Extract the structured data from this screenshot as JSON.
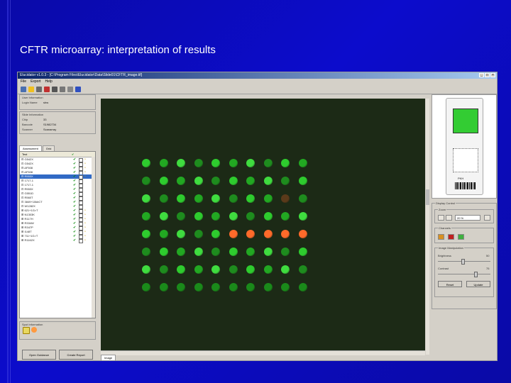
{
  "slide": {
    "title": "CFTR microarray: interpretation of results"
  },
  "window": {
    "title": "Elucidator v1.0.3 - [C:\\Program Files\\Elucidator\\Data\\Slide01\\CFTR_image.tif]",
    "menu": [
      "File",
      "Export",
      "Help"
    ]
  },
  "left": {
    "user_info": {
      "title": "User Information",
      "name_label": "Login Name",
      "name_value": "shw"
    },
    "slide_info": {
      "title": "Slide Information",
      "rows": [
        {
          "label": "Chip",
          "value": "33"
        },
        {
          "label": "Barcode",
          "value": "S1982734"
        },
        {
          "label": "Scanner",
          "value": "Scanarray"
        }
      ]
    },
    "tabs": [
      "Assessment",
      "Grid"
    ],
    "tree_header": "Test",
    "tree_items": [
      {
        "label": "⊟ G542X",
        "check": "none"
      },
      {
        "label": "    ⊡ G542X",
        "check": "none"
      },
      {
        "label": "⊟ ΔF508",
        "check": "none"
      },
      {
        "label": "    ⊡ ΔF508",
        "check": "none"
      },
      {
        "label": "⊟ R553X",
        "check": "none"
      },
      {
        "label": "    ⊟ 1717-1",
        "check": "none"
      },
      {
        "label": "      ⊡ 1717-1",
        "check": "none"
      },
      {
        "label": "      ⊡ R553X",
        "check": "none"
      },
      {
        "label": "      ⊡ G551D",
        "check": "none"
      },
      {
        "label": "      ⊡ R560T",
        "check": "none"
      },
      {
        "label": "      ⊡ 3849+10kbCT",
        "check": "none"
      },
      {
        "label": "      ⊡ W1282X",
        "check": "none"
      },
      {
        "label": "⊞ 621+1G>T",
        "check": "none"
      },
      {
        "label": "⊞ N1303K",
        "check": "none"
      },
      {
        "label": "⊞ R117H",
        "check": "none"
      },
      {
        "label": "⊞ R334W",
        "check": "none"
      },
      {
        "label": "⊞ R347P",
        "check": "none"
      },
      {
        "label": "⊞ I148T",
        "check": "none"
      },
      {
        "label": "⊞ 711+1G>T",
        "check": "none"
      },
      {
        "label": "⊞ R1162X",
        "check": "none"
      }
    ],
    "spot_info": {
      "title": "Spot Information"
    },
    "buttons": {
      "open": "Open Guidance",
      "create": "Create Report"
    }
  },
  "image": {
    "bottom_tab": "Image"
  },
  "right": {
    "chip_code": "PKH",
    "display_control": "Display Control",
    "zoom_legend": "Zoom",
    "zoom_value": "20 %",
    "channels_legend": "Channels",
    "image_manip_legend": "Image Manipulation",
    "brightness_label": "Brightness",
    "brightness_value": "50",
    "contrast_label": "Contrast",
    "contrast_value": "75",
    "reset_label": "Reset",
    "update_label": "Update"
  }
}
